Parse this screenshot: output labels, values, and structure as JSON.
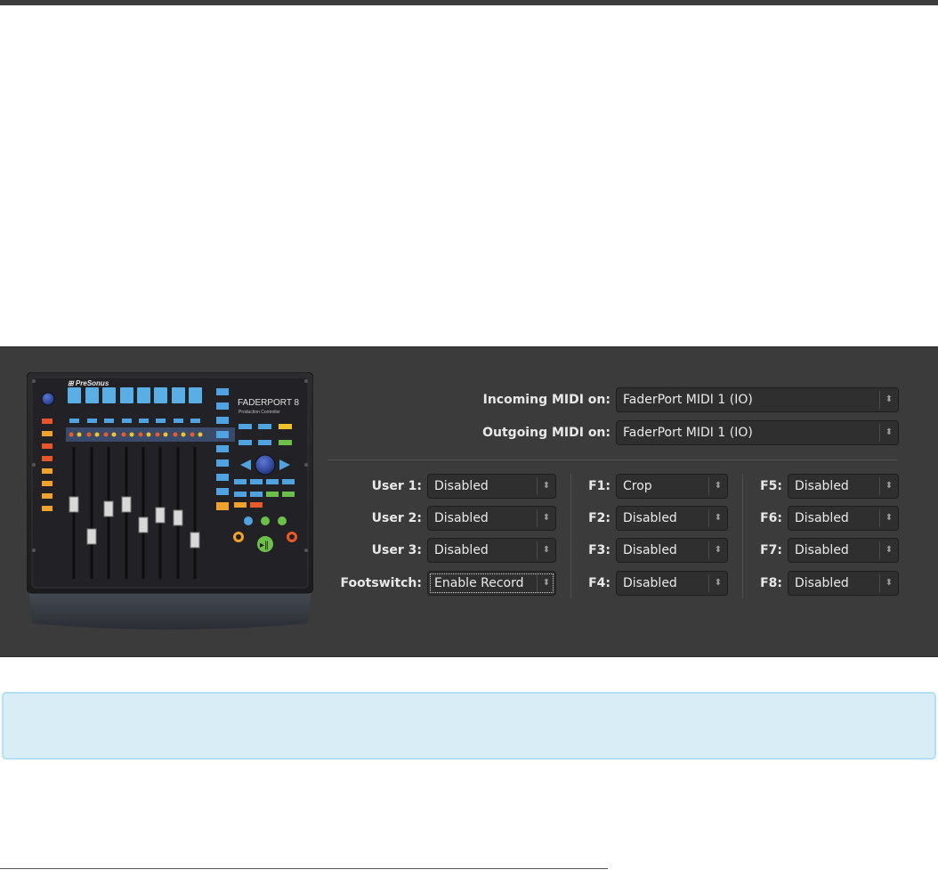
{
  "device": {
    "brand": "PreSonus",
    "model": "FADERPORT 8",
    "subtitle": "Production Controller"
  },
  "midi": {
    "incoming_label": "Incoming MIDI on:",
    "incoming_value": "FaderPort MIDI 1 (IO)",
    "outgoing_label": "Outgoing MIDI on:",
    "outgoing_value": "FaderPort MIDI 1 (IO)"
  },
  "user": [
    {
      "label": "User 1:",
      "value": "Disabled"
    },
    {
      "label": "User 2:",
      "value": "Disabled"
    },
    {
      "label": "User 3:",
      "value": "Disabled"
    },
    {
      "label": "Footswitch:",
      "value": "Enable Record"
    }
  ],
  "fkeys_a": [
    {
      "label": "F1:",
      "value": "Crop"
    },
    {
      "label": "F2:",
      "value": "Disabled"
    },
    {
      "label": "F3:",
      "value": "Disabled"
    },
    {
      "label": "F4:",
      "value": "Disabled"
    }
  ],
  "fkeys_b": [
    {
      "label": "F5:",
      "value": "Disabled"
    },
    {
      "label": "F6:",
      "value": "Disabled"
    },
    {
      "label": "F7:",
      "value": "Disabled"
    },
    {
      "label": "F8:",
      "value": "Disabled"
    }
  ],
  "icons": {
    "combo_arrow": "updown-chevron-icon"
  }
}
